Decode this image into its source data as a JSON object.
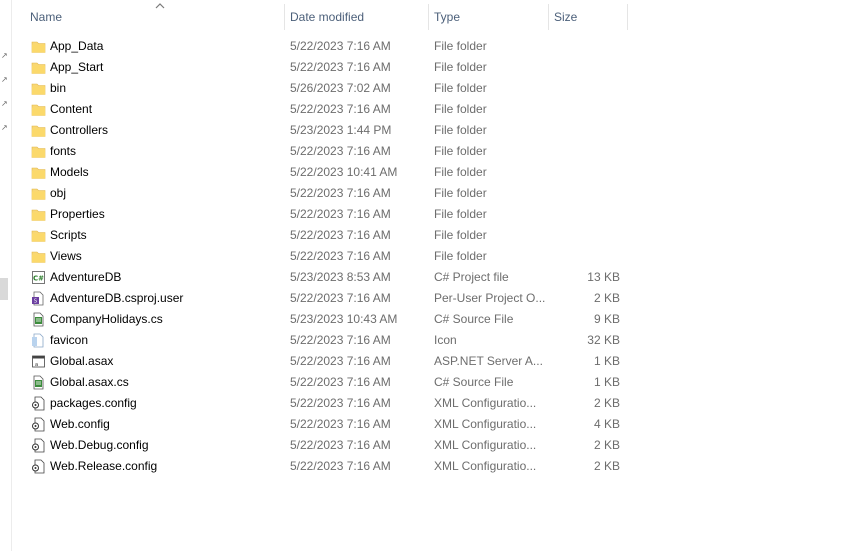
{
  "columns": {
    "name": "Name",
    "date": "Date modified",
    "type": "Type",
    "size": "Size"
  },
  "sort": {
    "column": "name",
    "direction": "ascending",
    "icon": "sort-up-arrow-icon"
  },
  "colors": {
    "folder": "#f8d775",
    "header_text": "#4c607a",
    "meta_text": "#6d6d6d"
  },
  "files": [
    {
      "name": "App_Data",
      "date": "5/22/2023 7:16 AM",
      "type": "File folder",
      "size": "",
      "icon": "folder-icon"
    },
    {
      "name": "App_Start",
      "date": "5/22/2023 7:16 AM",
      "type": "File folder",
      "size": "",
      "icon": "folder-icon"
    },
    {
      "name": "bin",
      "date": "5/26/2023 7:02 AM",
      "type": "File folder",
      "size": "",
      "icon": "folder-icon"
    },
    {
      "name": "Content",
      "date": "5/22/2023 7:16 AM",
      "type": "File folder",
      "size": "",
      "icon": "folder-icon"
    },
    {
      "name": "Controllers",
      "date": "5/23/2023 1:44 PM",
      "type": "File folder",
      "size": "",
      "icon": "folder-icon"
    },
    {
      "name": "fonts",
      "date": "5/22/2023 7:16 AM",
      "type": "File folder",
      "size": "",
      "icon": "folder-icon"
    },
    {
      "name": "Models",
      "date": "5/22/2023 10:41 AM",
      "type": "File folder",
      "size": "",
      "icon": "folder-icon"
    },
    {
      "name": "obj",
      "date": "5/22/2023 7:16 AM",
      "type": "File folder",
      "size": "",
      "icon": "folder-icon"
    },
    {
      "name": "Properties",
      "date": "5/22/2023 7:16 AM",
      "type": "File folder",
      "size": "",
      "icon": "folder-icon"
    },
    {
      "name": "Scripts",
      "date": "5/22/2023 7:16 AM",
      "type": "File folder",
      "size": "",
      "icon": "folder-icon"
    },
    {
      "name": "Views",
      "date": "5/22/2023 7:16 AM",
      "type": "File folder",
      "size": "",
      "icon": "folder-icon"
    },
    {
      "name": "AdventureDB",
      "date": "5/23/2023 8:53 AM",
      "type": "C# Project file",
      "size": "13 KB",
      "icon": "csharp-project-icon"
    },
    {
      "name": "AdventureDB.csproj.user",
      "date": "5/22/2023 7:16 AM",
      "type": "Per-User Project O...",
      "size": "2 KB",
      "icon": "user-project-icon"
    },
    {
      "name": "CompanyHolidays.cs",
      "date": "5/23/2023 10:43 AM",
      "type": "C# Source File",
      "size": "9 KB",
      "icon": "csharp-source-icon"
    },
    {
      "name": "favicon",
      "date": "5/22/2023 7:16 AM",
      "type": "Icon",
      "size": "32 KB",
      "icon": "image-file-icon"
    },
    {
      "name": "Global.asax",
      "date": "5/22/2023 7:16 AM",
      "type": "ASP.NET Server A...",
      "size": "1 KB",
      "icon": "aspnet-file-icon"
    },
    {
      "name": "Global.asax.cs",
      "date": "5/22/2023 7:16 AM",
      "type": "C# Source File",
      "size": "1 KB",
      "icon": "csharp-source-icon"
    },
    {
      "name": "packages.config",
      "date": "5/22/2023 7:16 AM",
      "type": "XML Configuratio...",
      "size": "2 KB",
      "icon": "config-file-icon"
    },
    {
      "name": "Web.config",
      "date": "5/22/2023 7:16 AM",
      "type": "XML Configuratio...",
      "size": "4 KB",
      "icon": "config-file-icon"
    },
    {
      "name": "Web.Debug.config",
      "date": "5/22/2023 7:16 AM",
      "type": "XML Configuratio...",
      "size": "2 KB",
      "icon": "config-file-icon"
    },
    {
      "name": "Web.Release.config",
      "date": "5/22/2023 7:16 AM",
      "type": "XML Configuratio...",
      "size": "2 KB",
      "icon": "config-file-icon"
    }
  ]
}
